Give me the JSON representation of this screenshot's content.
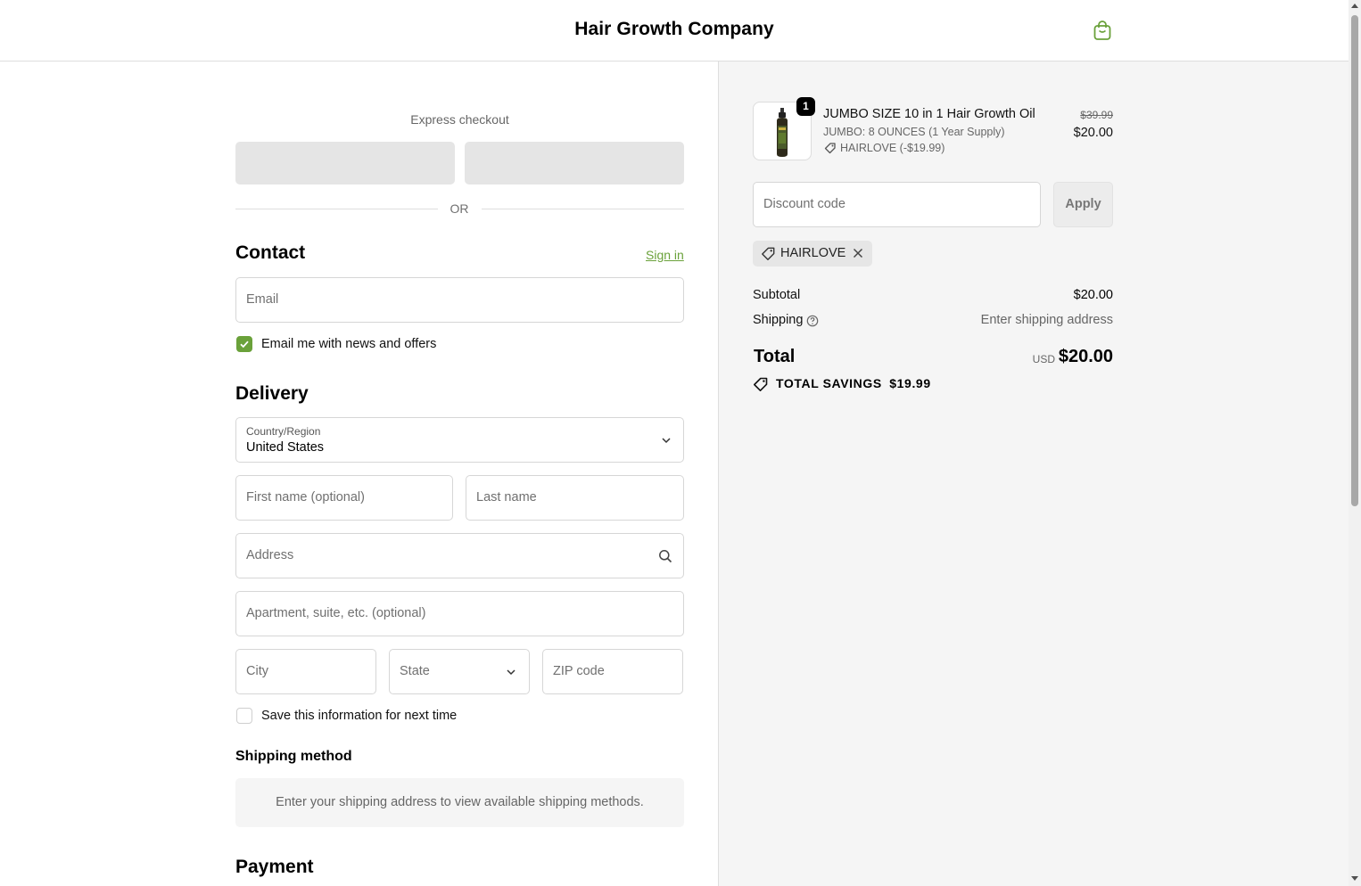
{
  "header": {
    "brand": "Hair Growth Company",
    "cart_icon": "shopping-bag-icon",
    "accent_color": "#6aa13a"
  },
  "express": {
    "label": "Express checkout",
    "or_text": "OR"
  },
  "contact": {
    "title": "Contact",
    "sign_in": "Sign in",
    "email_placeholder": "Email",
    "newsletter_label": "Email me with news and offers",
    "newsletter_checked": true
  },
  "delivery": {
    "title": "Delivery",
    "country_label": "Country/Region",
    "country_value": "United States",
    "first_name_placeholder": "First name (optional)",
    "last_name_placeholder": "Last name",
    "address_placeholder": "Address",
    "apartment_placeholder": "Apartment, suite, etc. (optional)",
    "city_placeholder": "City",
    "state_placeholder": "State",
    "zip_placeholder": "ZIP code",
    "save_info_label": "Save this information for next time",
    "save_info_checked": false
  },
  "shipping_method": {
    "title": "Shipping method",
    "message": "Enter your shipping address to view available shipping methods."
  },
  "payment": {
    "title": "Payment"
  },
  "summary": {
    "item": {
      "quantity": "1",
      "name": "JUMBO SIZE 10 in 1 Hair Growth Oil",
      "variant": "JUMBO: 8 OUNCES (1 Year Supply)",
      "discount": "HAIRLOVE (-$19.99)",
      "original_price": "$39.99",
      "price": "$20.00"
    },
    "discount_placeholder": "Discount code",
    "apply_label": "Apply",
    "applied_code": "HAIRLOVE",
    "subtotal_label": "Subtotal",
    "subtotal_value": "$20.00",
    "shipping_label": "Shipping",
    "shipping_value": "Enter shipping address",
    "total_label": "Total",
    "currency": "USD",
    "total_value": "$20.00",
    "savings_label": "TOTAL SAVINGS",
    "savings_value": "$19.99"
  }
}
